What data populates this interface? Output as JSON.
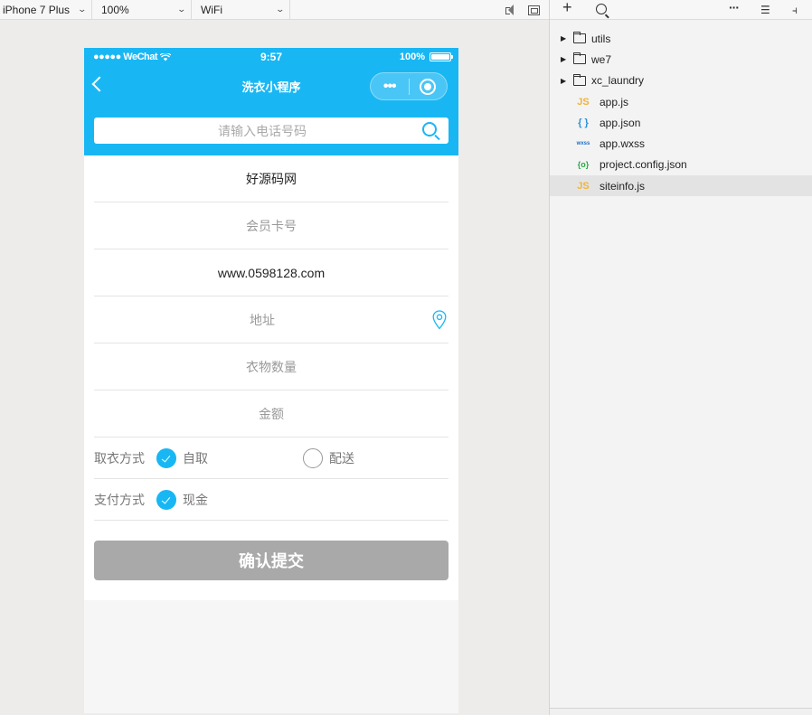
{
  "toolbar": {
    "device": "iPhone 7 Plus",
    "zoom": "100%",
    "network": "WiFi"
  },
  "status_bar": {
    "carrier": "●●●●● WeChat",
    "time": "9:57",
    "battery": "100%",
    "battery_level": 1.0
  },
  "nav": {
    "title": "洗衣小程序",
    "more": "•••"
  },
  "search": {
    "placeholder": "请输入电话号码"
  },
  "form": {
    "shop_name": "好源码网",
    "member_card_placeholder": "会员卡号",
    "website": "www.0598128.com",
    "address_placeholder": "地址",
    "clothes_count_placeholder": "衣物数量",
    "amount_placeholder": "金额",
    "pickup_label": "取衣方式",
    "pickup_options": [
      {
        "label": "自取",
        "checked": true
      },
      {
        "label": "配送",
        "checked": false
      }
    ],
    "payment_label": "支付方式",
    "payment_options": [
      {
        "label": "现金",
        "checked": true
      }
    ],
    "submit_label": "确认提交"
  },
  "file_tree": {
    "items": [
      {
        "name": "utils",
        "type": "folder"
      },
      {
        "name": "we7",
        "type": "folder"
      },
      {
        "name": "xc_laundry",
        "type": "folder"
      },
      {
        "name": "app.js",
        "type": "js",
        "icon": "JS"
      },
      {
        "name": "app.json",
        "type": "json",
        "icon": "{ }"
      },
      {
        "name": "app.wxss",
        "type": "wxss",
        "icon": "wxss"
      },
      {
        "name": "project.config.json",
        "type": "config",
        "icon": "{o}"
      },
      {
        "name": "siteinfo.js",
        "type": "js",
        "icon": "JS",
        "selected": true
      }
    ]
  },
  "colors": {
    "brand": "#18b7f4",
    "submit_disabled": "#a9a9a9"
  }
}
